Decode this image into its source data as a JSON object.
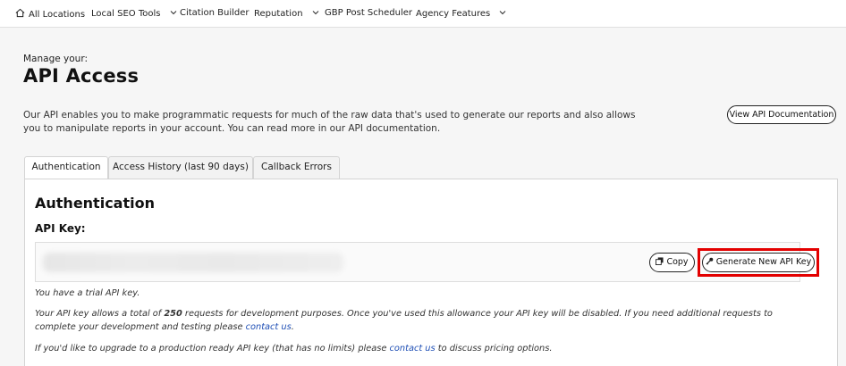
{
  "nav": {
    "home": "All Locations",
    "items": [
      {
        "label": "Local SEO Tools",
        "dropdown": true
      },
      {
        "label": "Citation Builder",
        "dropdown": false
      },
      {
        "label": "Reputation",
        "dropdown": true
      },
      {
        "label": "GBP Post Scheduler",
        "dropdown": false
      },
      {
        "label": "Agency Features",
        "dropdown": true
      }
    ]
  },
  "header": {
    "manage_label": "Manage your:",
    "title": "API Access",
    "intro": "Our API enables you to make programmatic requests for much of the raw data that's used to generate our reports and also allows you to manipulate reports in your account. You can read more in our API documentation.",
    "docs_button": "View API Documentation"
  },
  "tabs": [
    {
      "label": "Authentication",
      "active": true
    },
    {
      "label": "Access History (last 90 days)",
      "active": false
    },
    {
      "label": "Callback Errors",
      "active": false
    }
  ],
  "auth": {
    "title": "Authentication",
    "key_label": "API Key:",
    "copy_button": "Copy",
    "generate_button": "Generate New API Key",
    "trial_note": "You have a trial API key.",
    "allowance_pre": "Your API key allows a total of ",
    "allowance_count": "250",
    "allowance_post": " requests for development purposes. Once you've used this allowance your API key will be disabled. If you need additional requests to complete your development and testing please ",
    "contact_link": "contact us",
    "allowance_end": ".",
    "upgrade_pre": "If you'd like to upgrade to a production ready API key (that has no limits) please ",
    "upgrade_link": "contact us",
    "upgrade_post": " to discuss pricing options."
  },
  "colors": {
    "highlight": "#e30000",
    "link": "#1f4fb5"
  }
}
